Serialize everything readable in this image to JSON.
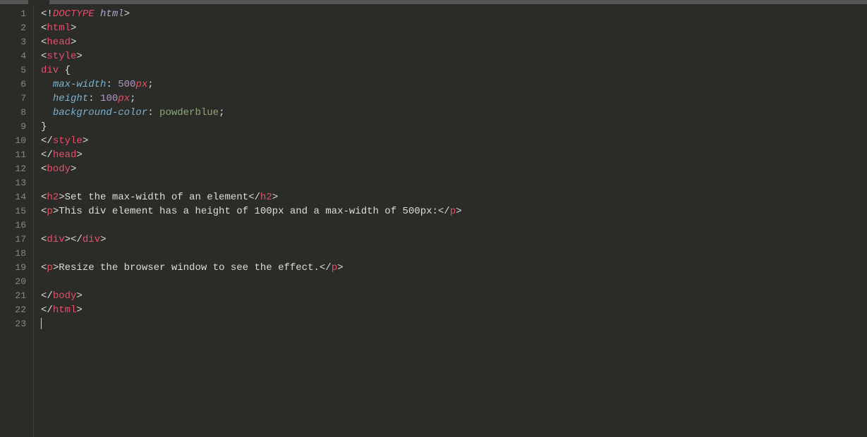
{
  "lineCount": 23,
  "cursorLine": 23,
  "code": {
    "l1": {
      "open": "<!",
      "doctype": "DOCTYPE",
      "sp": " ",
      "html": "html",
      "close": ">"
    },
    "l2": {
      "open": "<",
      "tag": "html",
      "close": ">"
    },
    "l3": {
      "open": "<",
      "tag": "head",
      "close": ">"
    },
    "l4": {
      "open": "<",
      "tag": "style",
      "close": ">"
    },
    "l5": {
      "sel": "div",
      "sp": " ",
      "brace": "{"
    },
    "l6": {
      "indent": "  ",
      "prop": "max-width",
      "colon": ": ",
      "num": "500",
      "unit": "px",
      "semi": ";"
    },
    "l7": {
      "indent": "  ",
      "prop": "height",
      "colon": ": ",
      "num": "100",
      "unit": "px",
      "semi": ";"
    },
    "l8": {
      "indent": "  ",
      "prop": "background-color",
      "colon": ": ",
      "val": "powderblue",
      "semi": ";"
    },
    "l9": {
      "brace": "}"
    },
    "l10": {
      "open": "</",
      "tag": "style",
      "close": ">"
    },
    "l11": {
      "open": "</",
      "tag": "head",
      "close": ">"
    },
    "l12": {
      "open": "<",
      "tag": "body",
      "close": ">"
    },
    "l14": {
      "open": "<",
      "tag": "h2",
      "close": ">",
      "text": "Set the max-width of an element",
      "open2": "</",
      "tag2": "h2",
      "close2": ">"
    },
    "l15": {
      "open": "<",
      "tag": "p",
      "close": ">",
      "text": "This div element has a height of 100px and a max-width of 500px:",
      "open2": "</",
      "tag2": "p",
      "close2": ">"
    },
    "l17": {
      "open": "<",
      "tag": "div",
      "close": ">",
      "open2": "</",
      "tag2": "div",
      "close2": ">"
    },
    "l19": {
      "open": "<",
      "tag": "p",
      "close": ">",
      "text": "Resize the browser window to see the effect.",
      "open2": "</",
      "tag2": "p",
      "close2": ">"
    },
    "l21": {
      "open": "</",
      "tag": "body",
      "close": ">"
    },
    "l22": {
      "open": "</",
      "tag": "html",
      "close": ">"
    }
  }
}
